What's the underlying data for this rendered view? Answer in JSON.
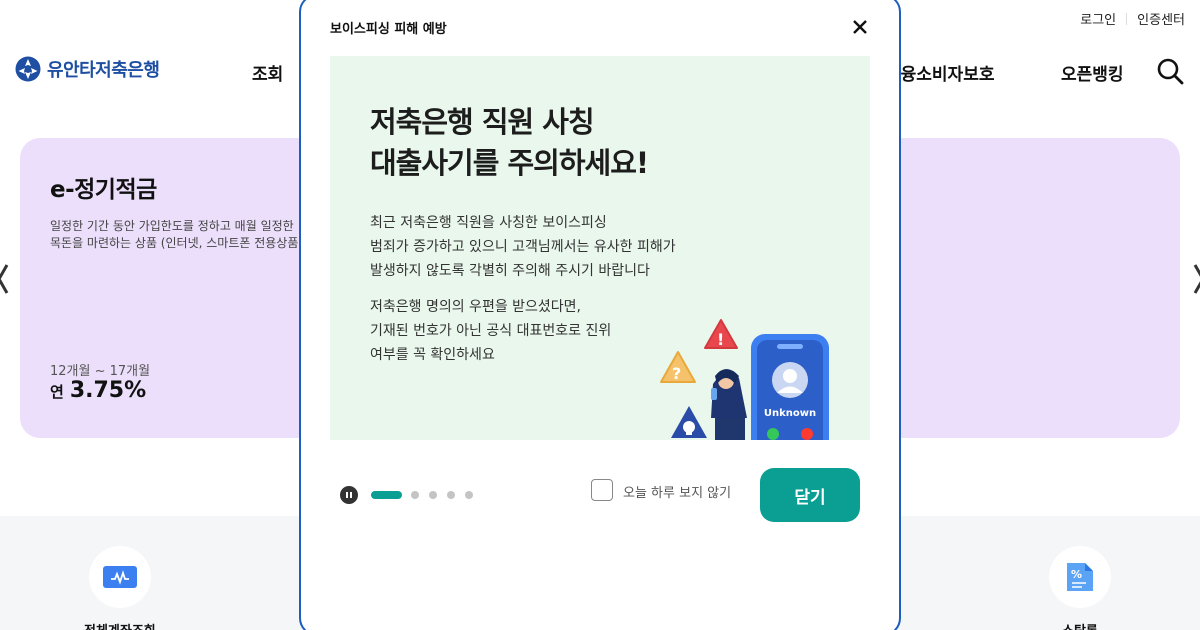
{
  "header": {
    "util_links": [
      "로그인",
      "인증센터"
    ],
    "logo_text": "유안타저축은행",
    "nav": [
      "조회",
      "금융소비자보호",
      "오픈뱅킹"
    ]
  },
  "product_card": {
    "title": "e-정기적금",
    "desc_line1": "일정한 기간 동안 가입한도를 정하고 매월 일정한",
    "desc_line2": "목돈을 마련하는 상품 (인터넷, 스마트폰 전용상품",
    "term": "12개월 ~ 17개월",
    "rate_prefix": "연",
    "rate": "3.75%"
  },
  "quick_menu": {
    "left_label": "전체계좌조회",
    "right_label": "스탁론"
  },
  "modal": {
    "title": "보이스피싱 피해 예방",
    "banner": {
      "headline_line1": "저축은행 직원 사칭",
      "headline_line2": "대출사기를 주의하세요!",
      "para1": [
        "최근 저축은행 직원을 사칭한 보이스피싱",
        "범죄가 증가하고 있으니 고객님께서는 유사한 피해가",
        "발생하지 않도록 각별히 주의해 주시기 바랍니다"
      ],
      "para2": [
        "저축은행 명의의 우편을 받으셨다면,",
        "기재된 번호가 아닌 공식 대표번호로 진위",
        "여부를 꼭 확인하세요"
      ],
      "phone_label": "Unknown"
    },
    "slides": {
      "count": 5,
      "active": 1
    },
    "dont_show_label": "오늘 하루 보지 않기",
    "close_label": "닫기"
  },
  "colors": {
    "accent": "#0a9f92",
    "brand_blue": "#1e4fa3",
    "card_bg": "#ecdffb",
    "banner_bg": "#e9f7ec",
    "modal_border": "#1d5fbf"
  },
  "icons": [
    "logo-mark-icon",
    "search-icon",
    "chevron-left-icon",
    "chevron-right-icon",
    "close-icon",
    "pause-icon",
    "account-icon",
    "stock-loan-icon",
    "warning-icon",
    "question-icon",
    "skull-icon",
    "user-icon"
  ]
}
